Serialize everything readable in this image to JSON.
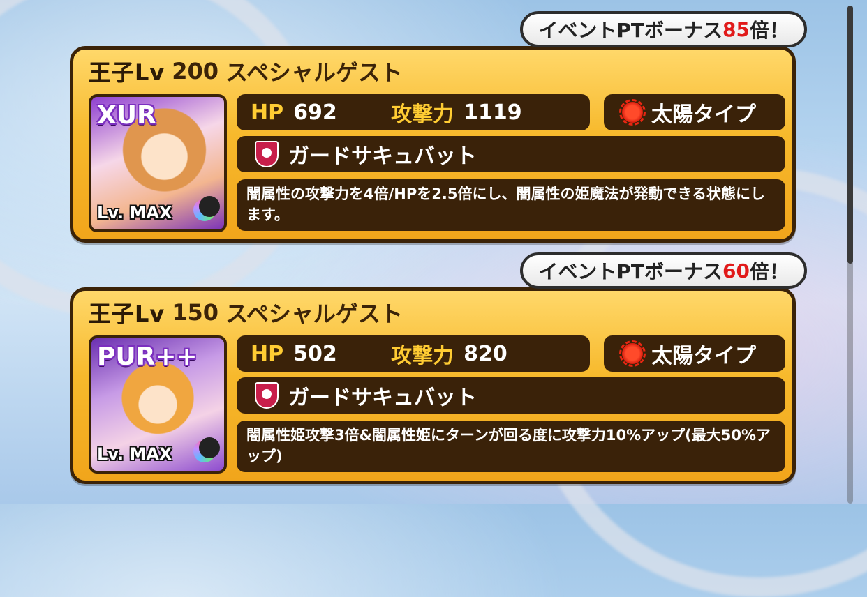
{
  "cards": [
    {
      "bonus_prefix": "イベントPTボーナス",
      "bonus_multiplier": "85",
      "bonus_suffix": "倍！",
      "level_label": "王子Lv",
      "level_value": "200",
      "guest_label": "スペシャルゲスト",
      "rarity": "XUR",
      "level_badge": "Lv. MAX",
      "hp_label": "HP",
      "hp_value": "692",
      "atk_label": "攻撃力",
      "atk_value": "1119",
      "type_label": "太陽タイプ",
      "skill_name": "ガードサキュバット",
      "skill_desc": "闇属性の攻撃力を4倍/HPを2.5倍にし、闇属性の姫魔法が発動できる状態にします。"
    },
    {
      "bonus_prefix": "イベントPTボーナス",
      "bonus_multiplier": "60",
      "bonus_suffix": "倍！",
      "level_label": "王子Lv",
      "level_value": "150",
      "guest_label": "スペシャルゲスト",
      "rarity": "PUR++",
      "level_badge": "Lv. MAX",
      "hp_label": "HP",
      "hp_value": "502",
      "atk_label": "攻撃力",
      "atk_value": "820",
      "type_label": "太陽タイプ",
      "skill_name": "ガードサキュバット",
      "skill_desc": "闇属性姫攻撃3倍&闇属性姫にターンが回る度に攻撃力10%アップ(最大50%アップ)"
    }
  ],
  "colors": {
    "panel": "#f7b92c",
    "bar": "#3a2209",
    "label": "#ffcc33",
    "multiplier": "#e11a1a"
  }
}
